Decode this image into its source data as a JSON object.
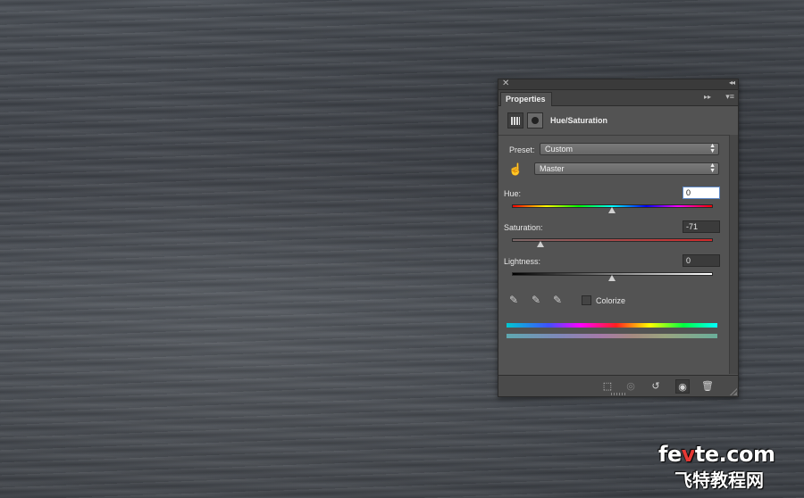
{
  "panel": {
    "close_glyph": "✕",
    "collapse_glyph": "◂◂",
    "tab_label": "Properties",
    "tab_forward_glyph": "▸▸",
    "tab_menu_glyph": "▾≡",
    "adjustment_title": "Hue/Saturation"
  },
  "preset": {
    "label": "Preset:",
    "value": "Custom"
  },
  "channel": {
    "value": "Master"
  },
  "hue": {
    "label": "Hue:",
    "value": "0"
  },
  "saturation": {
    "label": "Saturation:",
    "value": "-71"
  },
  "lightness": {
    "label": "Lightness:",
    "value": "0"
  },
  "colorize": {
    "label": "Colorize",
    "checked": false
  },
  "watermark": {
    "top_pre": "fe",
    "top_mid": "v",
    "top_post": "te.com",
    "bottom": "飞特教程网"
  }
}
